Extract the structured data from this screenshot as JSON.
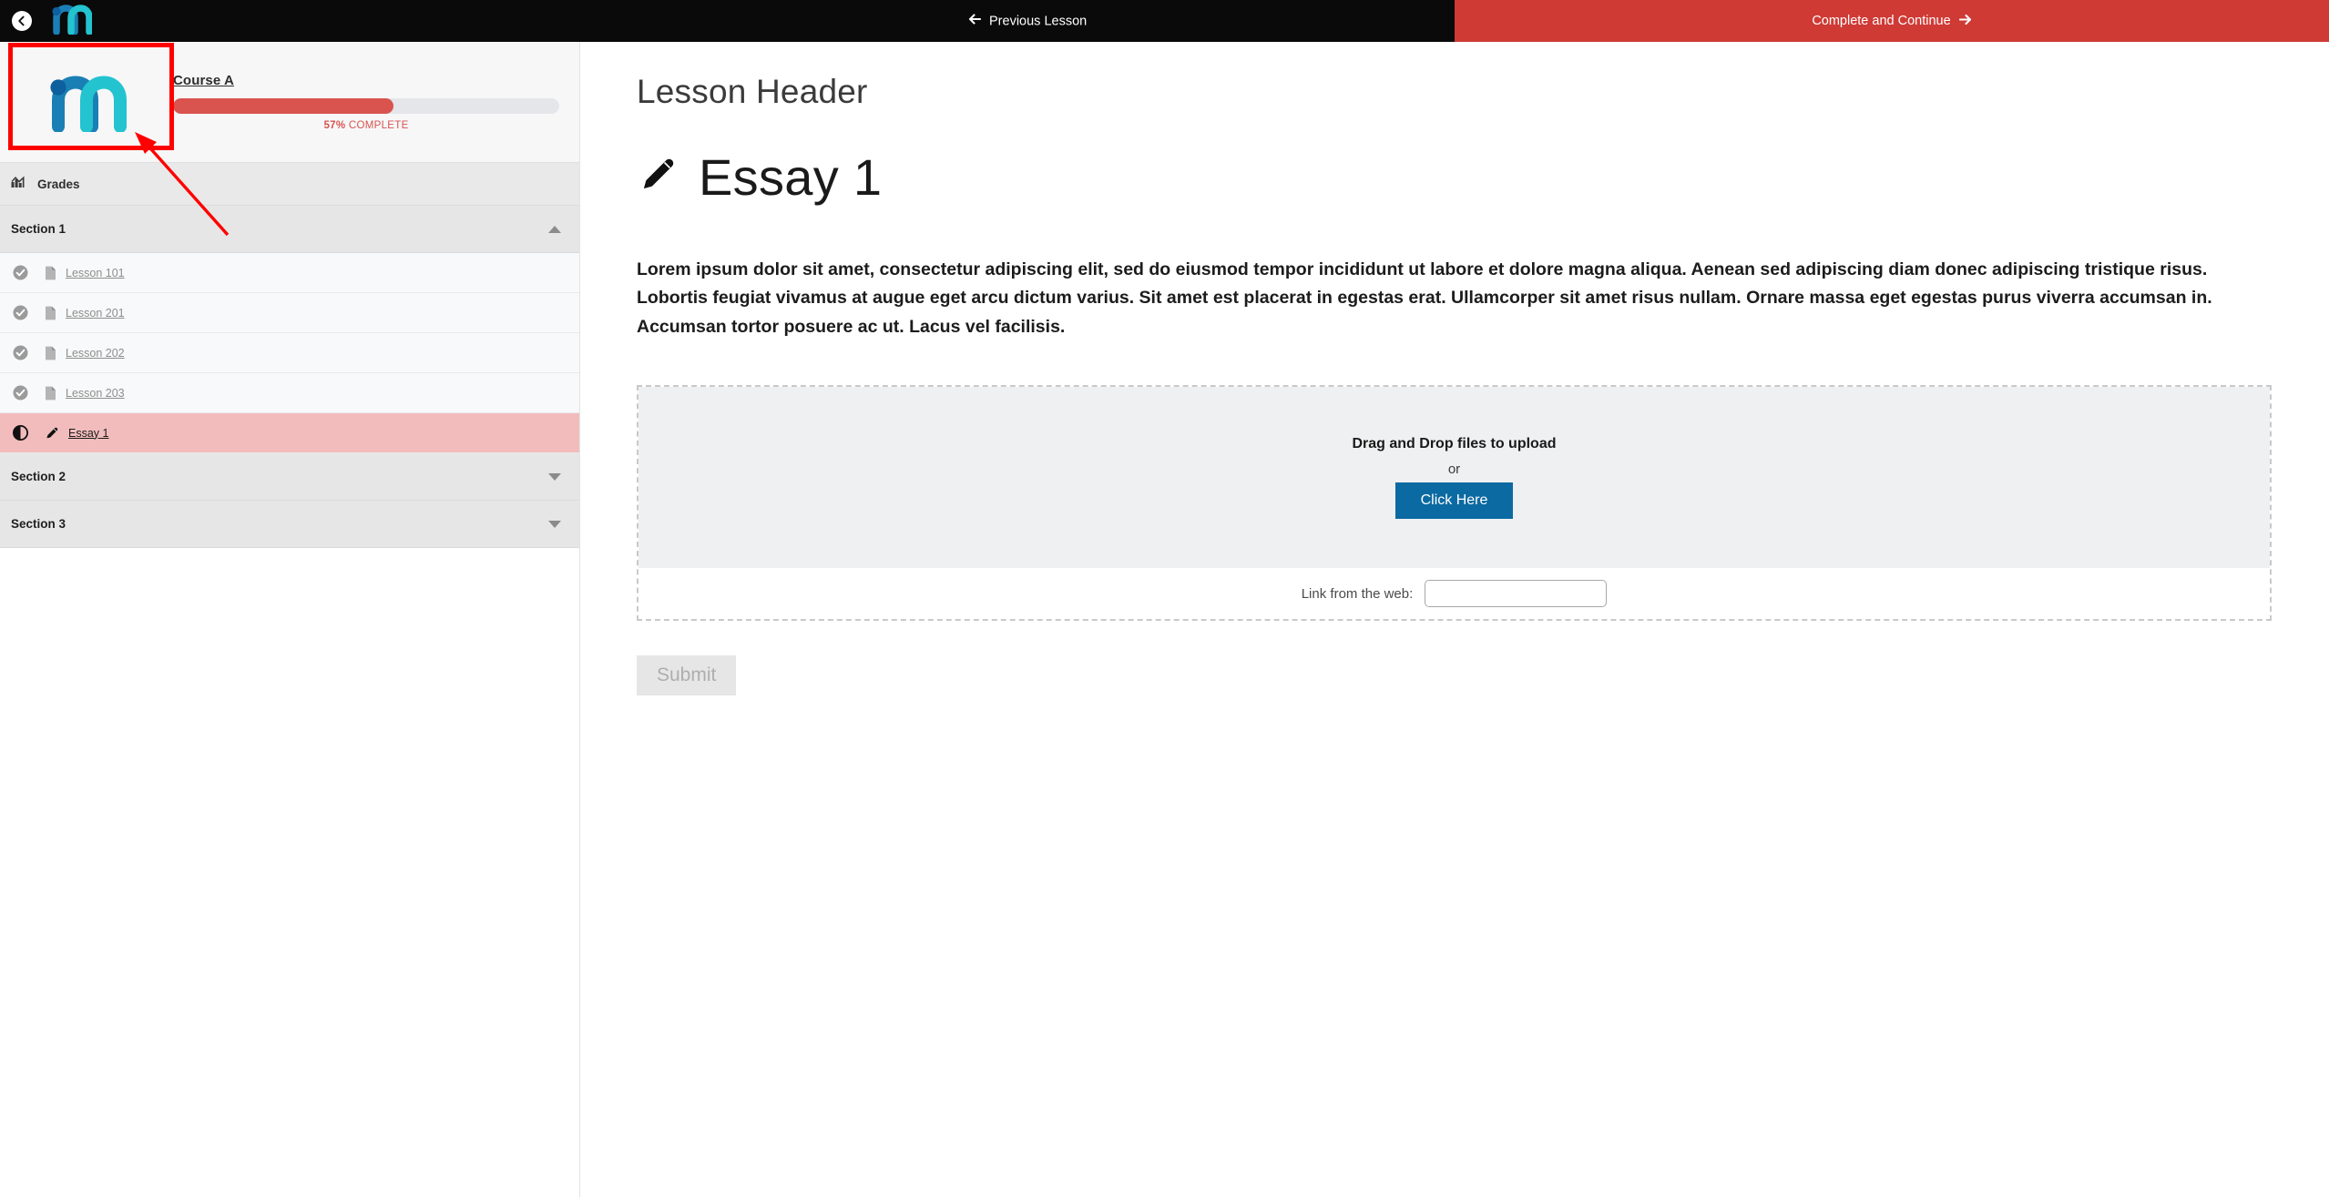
{
  "topbar": {
    "back_icon": "chevron-left-icon",
    "brand_icon": "m-logo-icon",
    "previous_lesson_label": "Previous Lesson",
    "previous_lesson_icon": "arrow-left-icon",
    "complete_continue_label": "Complete and Continue",
    "complete_continue_icon": "arrow-right-icon",
    "complete_continue_bg": "#cf3a35"
  },
  "sidebar": {
    "course_logo_icon": "m-logo-icon",
    "course_title": "Course A",
    "progress_percent": 57,
    "progress_percent_label": "57%",
    "progress_complete_label": "COMPLETE",
    "progress_color": "#d9534f",
    "grades": {
      "label": "Grades",
      "icon": "bar-chart-icon"
    },
    "sections": [
      {
        "label": "Section 1",
        "expanded": true,
        "chevron_icon": "chevron-up-icon",
        "items": [
          {
            "label": "Lesson 101",
            "status_icon": "check-circle-icon",
            "type_icon": "document-icon",
            "active": false
          },
          {
            "label": "Lesson 201",
            "status_icon": "check-circle-icon",
            "type_icon": "document-icon",
            "active": false
          },
          {
            "label": "Lesson 202",
            "status_icon": "check-circle-icon",
            "type_icon": "document-icon",
            "active": false
          },
          {
            "label": "Lesson 203",
            "status_icon": "check-circle-icon",
            "type_icon": "document-icon",
            "active": false
          },
          {
            "label": "Essay 1",
            "status_icon": "half-circle-icon",
            "type_icon": "pencil-icon",
            "active": true
          }
        ]
      },
      {
        "label": "Section 2",
        "expanded": false,
        "chevron_icon": "chevron-down-icon",
        "items": []
      },
      {
        "label": "Section 3",
        "expanded": false,
        "chevron_icon": "chevron-down-icon",
        "items": []
      }
    ]
  },
  "main": {
    "lesson_header": "Lesson Header",
    "title": "Essay 1",
    "title_icon": "pencil-icon",
    "body": "Lorem ipsum dolor sit amet, consectetur adipiscing elit, sed do eiusmod tempor incididunt ut labore et dolore magna aliqua. Aenean sed adipiscing diam donec adipiscing tristique risus. Lobortis feugiat vivamus at augue eget arcu dictum varius. Sit amet est placerat in egestas erat. Ullamcorper sit amet risus nullam. Ornare massa eget egestas purus viverra accumsan in. Accumsan tortor posuere ac ut. Lacus vel facilisis.",
    "dropzone": {
      "title": "Drag and Drop files to upload",
      "or_label": "or",
      "button_label": "Click Here",
      "button_color": "#0b6aa2",
      "link_label": "Link from the web:",
      "link_value": "",
      "link_placeholder": ""
    },
    "submit_label": "Submit",
    "submit_disabled": true
  },
  "annotation": {
    "highlight_color": "#ff0000",
    "arrow_icon": "pointer-arrow-icon"
  }
}
